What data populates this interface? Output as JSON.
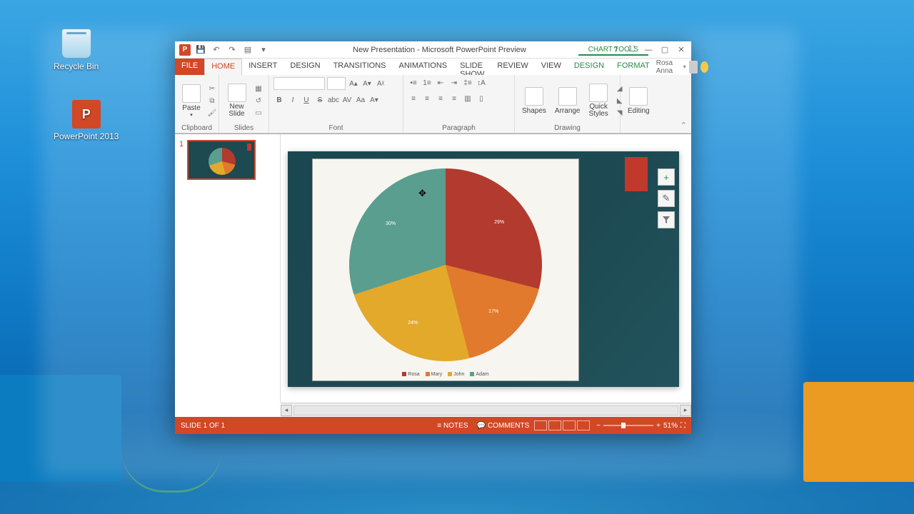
{
  "desktop": {
    "recycle_label": "Recycle Bin",
    "ppt_label": "PowerPoint 2013",
    "ppt_letter": "P"
  },
  "titlebar": {
    "title": "New Presentation - Microsoft PowerPoint Preview",
    "chart_tools": "CHART TOOLS"
  },
  "tabs": {
    "file": "FILE",
    "home": "HOME",
    "insert": "INSERT",
    "design": "DESIGN",
    "transitions": "TRANSITIONS",
    "animations": "ANIMATIONS",
    "slideshow": "SLIDE SHOW",
    "review": "REVIEW",
    "view": "VIEW",
    "ctx_design": "DESIGN",
    "ctx_format": "FORMAT",
    "user": "Rosa Anna"
  },
  "ribbon": {
    "paste": "Paste",
    "clipboard": "Clipboard",
    "new_slide": "New Slide",
    "slides": "Slides",
    "font": "Font",
    "paragraph": "Paragraph",
    "shapes": "Shapes",
    "arrange": "Arrange",
    "quick_styles": "Quick Styles",
    "drawing": "Drawing",
    "editing": "Editing"
  },
  "chart_data": {
    "type": "pie",
    "title": "",
    "series": [
      {
        "name": "Rosa",
        "value": 29,
        "label": "29%",
        "color": "#b23a2e"
      },
      {
        "name": "Mary",
        "value": 17,
        "label": "17%",
        "color": "#e17a2d"
      },
      {
        "name": "John",
        "value": 24,
        "label": "24%",
        "color": "#e3a92b"
      },
      {
        "name": "Adam",
        "value": 30,
        "label": "30%",
        "color": "#5a9e8f"
      }
    ],
    "legend_position": "bottom"
  },
  "side_buttons": {
    "add": "+",
    "brush": "✎",
    "filter": "▾"
  },
  "thumb": {
    "num": "1"
  },
  "status": {
    "slide": "SLIDE 1 OF 1",
    "notes": "NOTES",
    "comments": "COMMENTS",
    "zoom": "51%"
  }
}
